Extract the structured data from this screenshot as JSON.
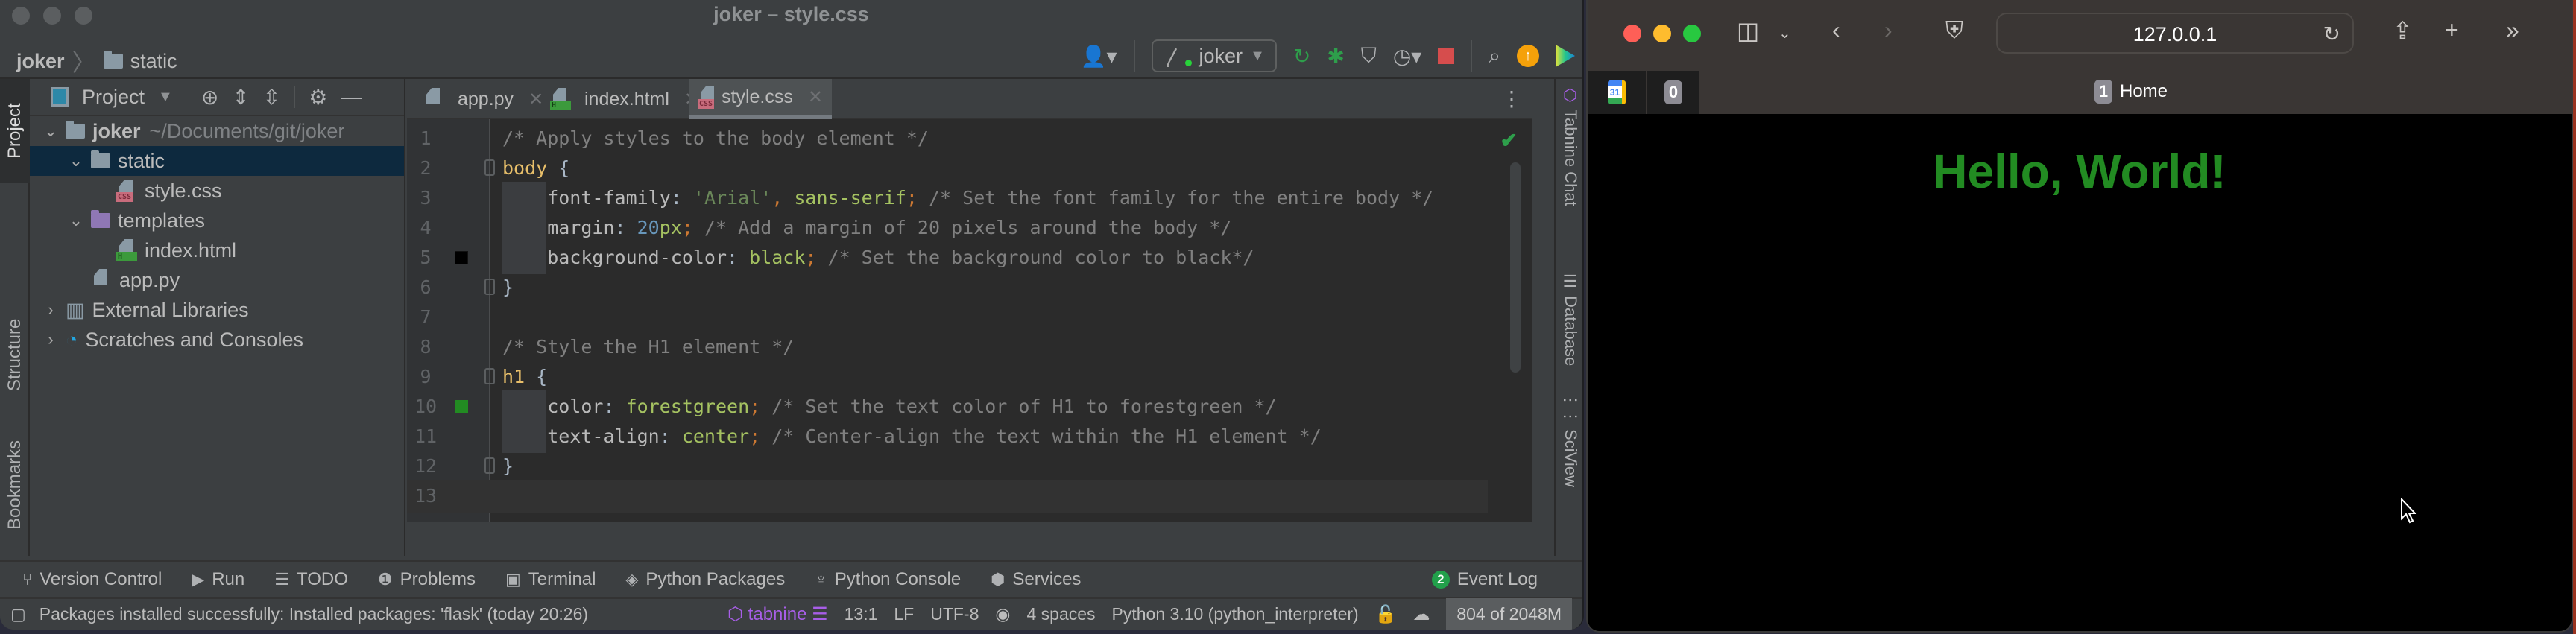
{
  "ide": {
    "window_title": "joker – style.css",
    "breadcrumb": [
      "joker",
      "static"
    ],
    "run_config": "joker",
    "left_tool_tabs": [
      "Project",
      "Structure",
      "Bookmarks"
    ],
    "right_tool_tabs": [
      "Tabnine Chat",
      "Database",
      "SciView"
    ],
    "project_panel": {
      "title": "Project",
      "tree": [
        {
          "label": "joker",
          "detail": "~/Documents/git/joker",
          "type": "folder",
          "level": 0,
          "expanded": true,
          "selected": false
        },
        {
          "label": "static",
          "type": "folder",
          "level": 1,
          "expanded": true,
          "selected": true
        },
        {
          "label": "style.css",
          "type": "css",
          "level": 2
        },
        {
          "label": "templates",
          "type": "folder-templates",
          "level": 1,
          "expanded": true
        },
        {
          "label": "index.html",
          "type": "html",
          "level": 2
        },
        {
          "label": "app.py",
          "type": "py",
          "level": 1
        },
        {
          "label": "External Libraries",
          "type": "libraries",
          "level": 0,
          "expanded": false
        },
        {
          "label": "Scratches and Consoles",
          "type": "scratches",
          "level": 0,
          "expanded": false
        }
      ]
    },
    "editor_tabs": [
      {
        "label": "app.py",
        "type": "py",
        "active": false
      },
      {
        "label": "index.html",
        "type": "html",
        "active": false
      },
      {
        "label": "style.css",
        "type": "css",
        "active": true
      }
    ],
    "code_lines": [
      {
        "n": "1",
        "tokens": [
          [
            "c-comment",
            "/* Apply styles to the body element */"
          ]
        ]
      },
      {
        "n": "2",
        "tokens": [
          [
            "c-sel",
            "body"
          ],
          [
            "c-brace",
            " {"
          ]
        ]
      },
      {
        "n": "3",
        "tokens": [
          [
            "c-prop",
            "    font-family"
          ],
          [
            "c-brace",
            ": "
          ],
          [
            "c-str",
            "'Arial'"
          ],
          [
            "c-punc",
            ", "
          ],
          [
            "c-val",
            "sans-serif"
          ],
          [
            "c-punc",
            ";"
          ],
          [
            "c-comment",
            " /* Set the font family for the entire body */"
          ]
        ]
      },
      {
        "n": "4",
        "tokens": [
          [
            "c-prop",
            "    margin"
          ],
          [
            "c-brace",
            ": "
          ],
          [
            "c-num",
            "20"
          ],
          [
            "c-val",
            "px"
          ],
          [
            "c-punc",
            ";"
          ],
          [
            "c-comment",
            " /* Add a margin of 20 pixels around the body */"
          ]
        ]
      },
      {
        "n": "5",
        "tokens": [
          [
            "c-prop",
            "    background-color"
          ],
          [
            "c-brace",
            ": "
          ],
          [
            "c-val",
            "black"
          ],
          [
            "c-punc",
            ";"
          ],
          [
            "c-comment",
            " /* Set the background color to black*/"
          ]
        ]
      },
      {
        "n": "6",
        "tokens": [
          [
            "c-brace",
            "}"
          ]
        ]
      },
      {
        "n": "7",
        "tokens": []
      },
      {
        "n": "8",
        "tokens": [
          [
            "c-comment",
            "/* Style the H1 element */"
          ]
        ]
      },
      {
        "n": "9",
        "tokens": [
          [
            "c-sel",
            "h1"
          ],
          [
            "c-brace",
            " {"
          ]
        ]
      },
      {
        "n": "10",
        "tokens": [
          [
            "c-prop",
            "    color"
          ],
          [
            "c-brace",
            ": "
          ],
          [
            "c-val",
            "forestgreen"
          ],
          [
            "c-punc",
            ";"
          ],
          [
            "c-comment",
            " /* Set the text color of H1 to forestgreen */"
          ]
        ]
      },
      {
        "n": "11",
        "tokens": [
          [
            "c-prop",
            "    text-align"
          ],
          [
            "c-brace",
            ": "
          ],
          [
            "c-val",
            "center"
          ],
          [
            "c-punc",
            ";"
          ],
          [
            "c-comment",
            " /* Center-align the text within the H1 element */"
          ]
        ]
      },
      {
        "n": "12",
        "tokens": [
          [
            "c-brace",
            "}"
          ]
        ]
      },
      {
        "n": "13",
        "tokens": []
      }
    ],
    "color_swatches": {
      "line5": "#000000",
      "line10": "#228b22"
    },
    "tool_windows": [
      "Version Control",
      "Run",
      "TODO",
      "Problems",
      "Terminal",
      "Python Packages",
      "Python Console",
      "Services"
    ],
    "event_log": {
      "label": "Event Log",
      "count": "2"
    },
    "status": {
      "message": "Packages installed successfully: Installed packages: 'flask' (today 20:26)",
      "tabnine": "tabnine",
      "position": "13:1",
      "line_ending": "LF",
      "encoding": "UTF-8",
      "indent": "4 spaces",
      "interpreter": "Python 3.10 (python_interpreter)",
      "memory": "804 of 2048M"
    }
  },
  "browser": {
    "url": "127.0.0.1",
    "pinned_tabs": [
      {
        "icon": "google-calendar",
        "label": "31"
      },
      {
        "icon": "count",
        "label": "0"
      }
    ],
    "tab": {
      "number": "1",
      "label": "Home"
    },
    "page_heading": "Hello, World!",
    "heading_color": "#228b22"
  }
}
